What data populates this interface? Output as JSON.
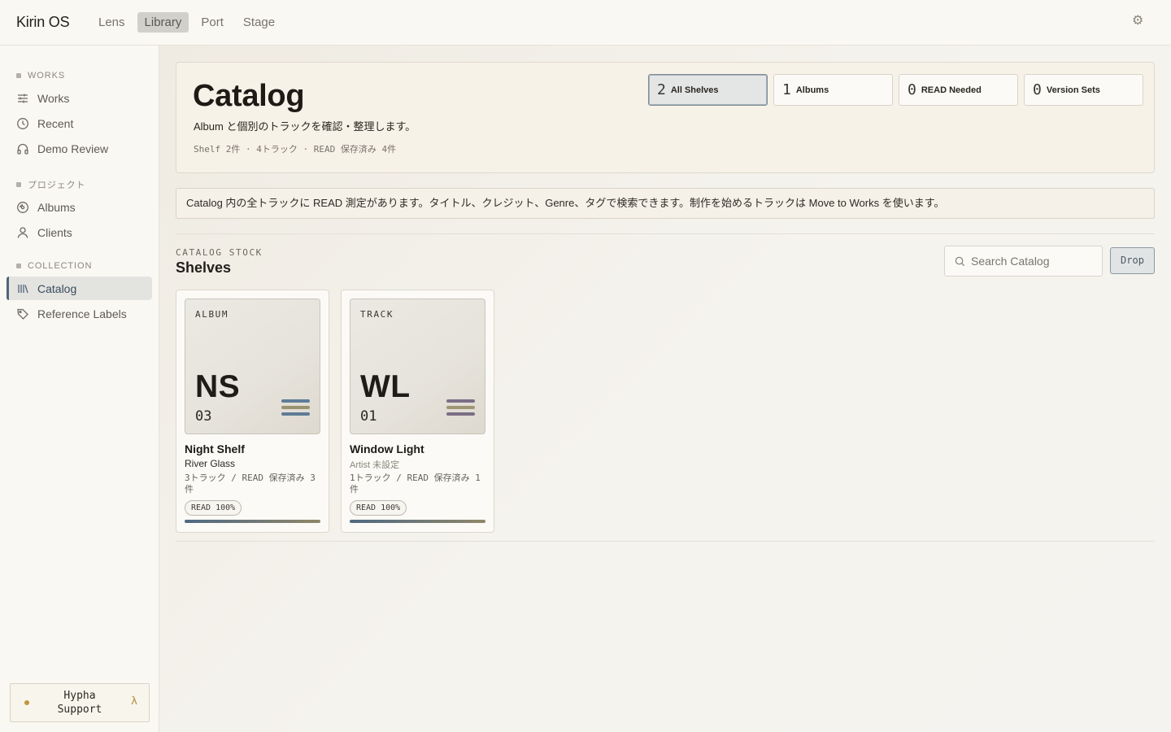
{
  "app": {
    "title": "Kirin OS"
  },
  "topnav": {
    "tabs": [
      {
        "label": "Lens",
        "active": false
      },
      {
        "label": "Library",
        "active": true
      },
      {
        "label": "Port",
        "active": false
      },
      {
        "label": "Stage",
        "active": false
      }
    ],
    "settings_icon": "gear-icon"
  },
  "sidebar": {
    "sections": [
      {
        "label": "WORKS",
        "items": [
          {
            "label": "Works",
            "icon": "sliders-icon"
          },
          {
            "label": "Recent",
            "icon": "clock-icon"
          },
          {
            "label": "Demo Review",
            "icon": "headphones-icon"
          }
        ]
      },
      {
        "label": "プロジェクト",
        "items": [
          {
            "label": "Albums",
            "icon": "disc-icon"
          },
          {
            "label": "Clients",
            "icon": "user-icon"
          }
        ]
      },
      {
        "label": "COLLECTION",
        "items": [
          {
            "label": "Catalog",
            "icon": "library-icon",
            "active": true
          },
          {
            "label": "Reference Labels",
            "icon": "tag-icon"
          }
        ]
      }
    ],
    "support": {
      "label": "Hypha Support",
      "icon": "lambda-icon"
    }
  },
  "hero": {
    "title": "Catalog",
    "subtitle": "Album と個別のトラックを確認・整理します。",
    "meta": "Shelf 2件 · 4トラック · READ 保存済み 4件",
    "stats": [
      {
        "value": "2",
        "label": "All Shelves",
        "active": true
      },
      {
        "value": "1",
        "label": "Albums",
        "active": false
      },
      {
        "value": "0",
        "label": "READ Needed",
        "active": false
      },
      {
        "value": "0",
        "label": "Version Sets",
        "active": false
      }
    ]
  },
  "notice": "Catalog 内の全トラックに READ 測定があります。タイトル、クレジット、Genre、タグで検索できます。制作を始めるトラックは Move to Works を使います。",
  "shelves": {
    "eyebrow": "CATALOG STOCK",
    "title": "Shelves",
    "search_placeholder": "Search Catalog",
    "drop_label": "Drop",
    "cards": [
      {
        "kind": "ALBUM",
        "code": "NS",
        "num": "03",
        "title": "Night Shelf",
        "artist": "River Glass",
        "artist_muted": false,
        "count": "3トラック / READ 保存済み 3件",
        "badge": "READ 100%",
        "progress": 1.0,
        "bar_colors": [
          "#5f7c97",
          "#9a9270",
          "#5f7c97"
        ]
      },
      {
        "kind": "TRACK",
        "code": "WL",
        "num": "01",
        "title": "Window Light",
        "artist": "Artist 未設定",
        "artist_muted": true,
        "count": "1トラック / READ 保存済み 1件",
        "badge": "READ 100%",
        "progress": 1.0,
        "bar_colors": [
          "#7a6e86",
          "#a09575",
          "#7a6e86"
        ]
      }
    ]
  }
}
